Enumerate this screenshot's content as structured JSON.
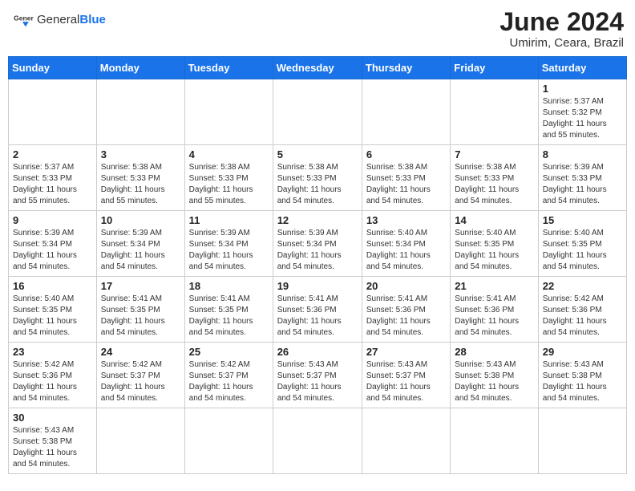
{
  "header": {
    "logo_general": "General",
    "logo_blue": "Blue",
    "title": "June 2024",
    "location": "Umirim, Ceara, Brazil"
  },
  "days_of_week": [
    "Sunday",
    "Monday",
    "Tuesday",
    "Wednesday",
    "Thursday",
    "Friday",
    "Saturday"
  ],
  "weeks": [
    [
      {
        "day": "",
        "info": ""
      },
      {
        "day": "",
        "info": ""
      },
      {
        "day": "",
        "info": ""
      },
      {
        "day": "",
        "info": ""
      },
      {
        "day": "",
        "info": ""
      },
      {
        "day": "",
        "info": ""
      },
      {
        "day": "1",
        "info": "Sunrise: 5:37 AM\nSunset: 5:32 PM\nDaylight: 11 hours\nand 55 minutes."
      }
    ],
    [
      {
        "day": "2",
        "info": "Sunrise: 5:37 AM\nSunset: 5:33 PM\nDaylight: 11 hours\nand 55 minutes."
      },
      {
        "day": "3",
        "info": "Sunrise: 5:38 AM\nSunset: 5:33 PM\nDaylight: 11 hours\nand 55 minutes."
      },
      {
        "day": "4",
        "info": "Sunrise: 5:38 AM\nSunset: 5:33 PM\nDaylight: 11 hours\nand 55 minutes."
      },
      {
        "day": "5",
        "info": "Sunrise: 5:38 AM\nSunset: 5:33 PM\nDaylight: 11 hours\nand 54 minutes."
      },
      {
        "day": "6",
        "info": "Sunrise: 5:38 AM\nSunset: 5:33 PM\nDaylight: 11 hours\nand 54 minutes."
      },
      {
        "day": "7",
        "info": "Sunrise: 5:38 AM\nSunset: 5:33 PM\nDaylight: 11 hours\nand 54 minutes."
      },
      {
        "day": "8",
        "info": "Sunrise: 5:39 AM\nSunset: 5:33 PM\nDaylight: 11 hours\nand 54 minutes."
      }
    ],
    [
      {
        "day": "9",
        "info": "Sunrise: 5:39 AM\nSunset: 5:34 PM\nDaylight: 11 hours\nand 54 minutes."
      },
      {
        "day": "10",
        "info": "Sunrise: 5:39 AM\nSunset: 5:34 PM\nDaylight: 11 hours\nand 54 minutes."
      },
      {
        "day": "11",
        "info": "Sunrise: 5:39 AM\nSunset: 5:34 PM\nDaylight: 11 hours\nand 54 minutes."
      },
      {
        "day": "12",
        "info": "Sunrise: 5:39 AM\nSunset: 5:34 PM\nDaylight: 11 hours\nand 54 minutes."
      },
      {
        "day": "13",
        "info": "Sunrise: 5:40 AM\nSunset: 5:34 PM\nDaylight: 11 hours\nand 54 minutes."
      },
      {
        "day": "14",
        "info": "Sunrise: 5:40 AM\nSunset: 5:35 PM\nDaylight: 11 hours\nand 54 minutes."
      },
      {
        "day": "15",
        "info": "Sunrise: 5:40 AM\nSunset: 5:35 PM\nDaylight: 11 hours\nand 54 minutes."
      }
    ],
    [
      {
        "day": "16",
        "info": "Sunrise: 5:40 AM\nSunset: 5:35 PM\nDaylight: 11 hours\nand 54 minutes."
      },
      {
        "day": "17",
        "info": "Sunrise: 5:41 AM\nSunset: 5:35 PM\nDaylight: 11 hours\nand 54 minutes."
      },
      {
        "day": "18",
        "info": "Sunrise: 5:41 AM\nSunset: 5:35 PM\nDaylight: 11 hours\nand 54 minutes."
      },
      {
        "day": "19",
        "info": "Sunrise: 5:41 AM\nSunset: 5:36 PM\nDaylight: 11 hours\nand 54 minutes."
      },
      {
        "day": "20",
        "info": "Sunrise: 5:41 AM\nSunset: 5:36 PM\nDaylight: 11 hours\nand 54 minutes."
      },
      {
        "day": "21",
        "info": "Sunrise: 5:41 AM\nSunset: 5:36 PM\nDaylight: 11 hours\nand 54 minutes."
      },
      {
        "day": "22",
        "info": "Sunrise: 5:42 AM\nSunset: 5:36 PM\nDaylight: 11 hours\nand 54 minutes."
      }
    ],
    [
      {
        "day": "23",
        "info": "Sunrise: 5:42 AM\nSunset: 5:36 PM\nDaylight: 11 hours\nand 54 minutes."
      },
      {
        "day": "24",
        "info": "Sunrise: 5:42 AM\nSunset: 5:37 PM\nDaylight: 11 hours\nand 54 minutes."
      },
      {
        "day": "25",
        "info": "Sunrise: 5:42 AM\nSunset: 5:37 PM\nDaylight: 11 hours\nand 54 minutes."
      },
      {
        "day": "26",
        "info": "Sunrise: 5:43 AM\nSunset: 5:37 PM\nDaylight: 11 hours\nand 54 minutes."
      },
      {
        "day": "27",
        "info": "Sunrise: 5:43 AM\nSunset: 5:37 PM\nDaylight: 11 hours\nand 54 minutes."
      },
      {
        "day": "28",
        "info": "Sunrise: 5:43 AM\nSunset: 5:38 PM\nDaylight: 11 hours\nand 54 minutes."
      },
      {
        "day": "29",
        "info": "Sunrise: 5:43 AM\nSunset: 5:38 PM\nDaylight: 11 hours\nand 54 minutes."
      }
    ],
    [
      {
        "day": "30",
        "info": "Sunrise: 5:43 AM\nSunset: 5:38 PM\nDaylight: 11 hours\nand 54 minutes."
      },
      {
        "day": "",
        "info": ""
      },
      {
        "day": "",
        "info": ""
      },
      {
        "day": "",
        "info": ""
      },
      {
        "day": "",
        "info": ""
      },
      {
        "day": "",
        "info": ""
      },
      {
        "day": "",
        "info": ""
      }
    ]
  ]
}
